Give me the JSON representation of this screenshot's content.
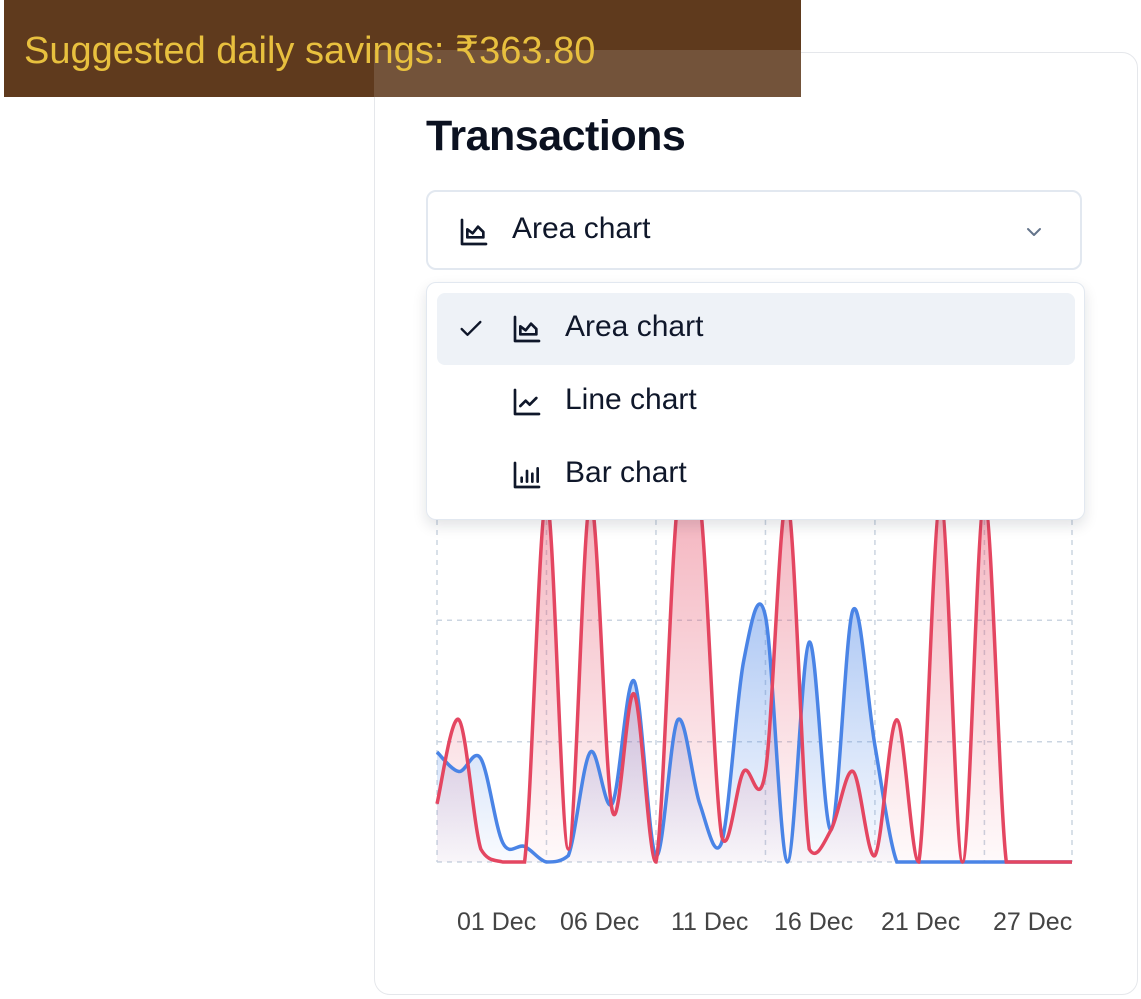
{
  "banner": {
    "text": "Suggested daily savings: ₹363.80"
  },
  "card": {
    "title": "Transactions"
  },
  "select": {
    "selected_label": "Area chart",
    "selected_icon": "area-chart-icon"
  },
  "menu": {
    "options": [
      {
        "label": "Area chart",
        "icon": "area-chart-icon",
        "selected": true
      },
      {
        "label": "Line chart",
        "icon": "line-chart-icon",
        "selected": false
      },
      {
        "label": "Bar chart",
        "icon": "bar-chart-icon",
        "selected": false
      }
    ]
  },
  "chart_data": {
    "type": "area",
    "x": [
      1,
      2,
      3,
      4,
      5,
      6,
      7,
      8,
      9,
      10,
      11,
      12,
      13,
      14,
      15,
      16,
      17,
      18,
      19,
      20,
      21,
      22,
      23,
      24,
      25,
      26,
      27,
      28,
      29,
      30
    ],
    "xticks": [
      "01 Dec",
      "06 Dec",
      "11 Dec",
      "16 Dec",
      "21 Dec",
      "27 Dec"
    ],
    "series": [
      {
        "color": "#4a84e6",
        "values": [
          0.85,
          0.7,
          0.8,
          0.15,
          0.12,
          0,
          0.05,
          0.85,
          0.45,
          1.4,
          0.05,
          1.1,
          0.45,
          0.15,
          1.55,
          1.9,
          0,
          1.7,
          0.25,
          1.95,
          0.9,
          0,
          0,
          0,
          0,
          0,
          0,
          0,
          0,
          0
        ]
      },
      {
        "color": "#e44661",
        "values": [
          0.45,
          1.1,
          0.1,
          0,
          0,
          2.8,
          0.1,
          2.8,
          0.4,
          1.3,
          0,
          2.8,
          2.8,
          0.2,
          0.7,
          0.7,
          2.8,
          0.1,
          0.25,
          0.7,
          0.05,
          1.1,
          0,
          2.8,
          0,
          2.8,
          0,
          0,
          0,
          0
        ]
      }
    ],
    "grid": true
  }
}
